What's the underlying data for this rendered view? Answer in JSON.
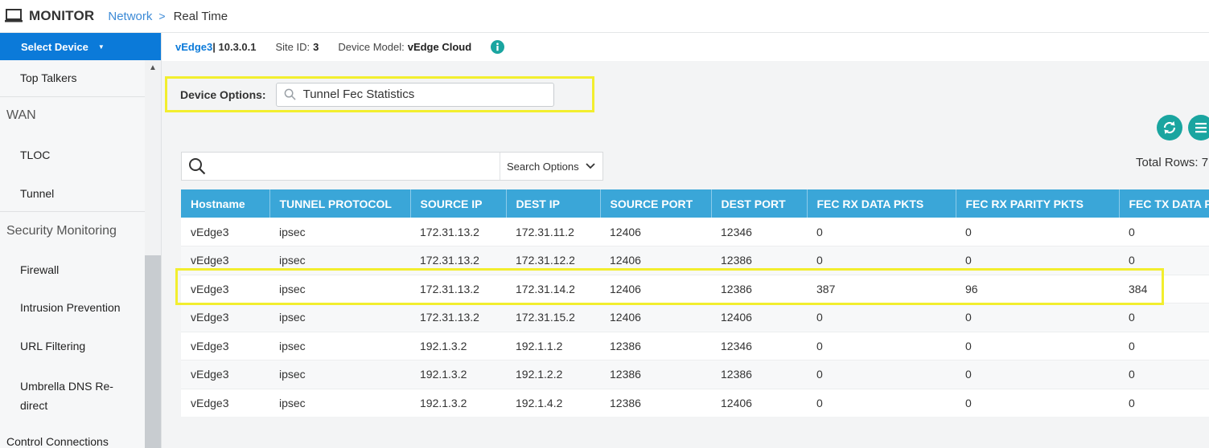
{
  "header": {
    "title": "MONITOR",
    "breadcrumb_link": "Network",
    "breadcrumb_sep": ">",
    "breadcrumb_current": "Real Time"
  },
  "sidebar": {
    "select_device_label": "Select Device",
    "items": [
      {
        "type": "item",
        "label": "Top Talkers"
      },
      {
        "type": "section",
        "label": "WAN"
      },
      {
        "type": "item",
        "label": "TLOC"
      },
      {
        "type": "item",
        "label": "Tunnel"
      },
      {
        "type": "section",
        "label": "Security Monitoring"
      },
      {
        "type": "item",
        "label": "Firewall"
      },
      {
        "type": "item",
        "label": "Intrusion Prevention"
      },
      {
        "type": "item",
        "label": "URL Filtering"
      },
      {
        "type": "item",
        "label": "Umbrella DNS Re-direct"
      },
      {
        "type": "item",
        "label": "Control Connections"
      }
    ]
  },
  "device": {
    "name": "vEdge3",
    "ip": " | 10.3.0.1",
    "site_label": "Site ID:",
    "site_value": "3",
    "model_label": "Device Model:",
    "model_value": "vEdge Cloud"
  },
  "device_options": {
    "label": "Device Options:",
    "value": "Tunnel Fec Statistics"
  },
  "search": {
    "options_label": "Search Options",
    "total_rows": "Total Rows: 7"
  },
  "table": {
    "columns": [
      "Hostname",
      "TUNNEL PROTOCOL",
      "SOURCE IP",
      "DEST IP",
      "SOURCE PORT",
      "DEST PORT",
      "FEC RX DATA PKTS",
      "FEC RX PARITY PKTS",
      "FEC TX DATA PKTS"
    ],
    "rows": [
      [
        "vEdge3",
        "ipsec",
        "172.31.13.2",
        "172.31.11.2",
        "12406",
        "12346",
        "0",
        "0",
        "0"
      ],
      [
        "vEdge3",
        "ipsec",
        "172.31.13.2",
        "172.31.12.2",
        "12406",
        "12386",
        "0",
        "0",
        "0"
      ],
      [
        "vEdge3",
        "ipsec",
        "172.31.13.2",
        "172.31.14.2",
        "12406",
        "12386",
        "387",
        "96",
        "384"
      ],
      [
        "vEdge3",
        "ipsec",
        "172.31.13.2",
        "172.31.15.2",
        "12406",
        "12406",
        "0",
        "0",
        "0"
      ],
      [
        "vEdge3",
        "ipsec",
        "192.1.3.2",
        "192.1.1.2",
        "12386",
        "12346",
        "0",
        "0",
        "0"
      ],
      [
        "vEdge3",
        "ipsec",
        "192.1.3.2",
        "192.1.2.2",
        "12386",
        "12386",
        "0",
        "0",
        "0"
      ],
      [
        "vEdge3",
        "ipsec",
        "192.1.3.2",
        "192.1.4.2",
        "12386",
        "12406",
        "0",
        "0",
        "0"
      ]
    ],
    "highlighted_row": 2
  },
  "colors": {
    "accent": "#0b7ad9",
    "table_header": "#3aa6d8",
    "highlight": "#f2ee2e",
    "action_button": "#1aa5a0"
  }
}
